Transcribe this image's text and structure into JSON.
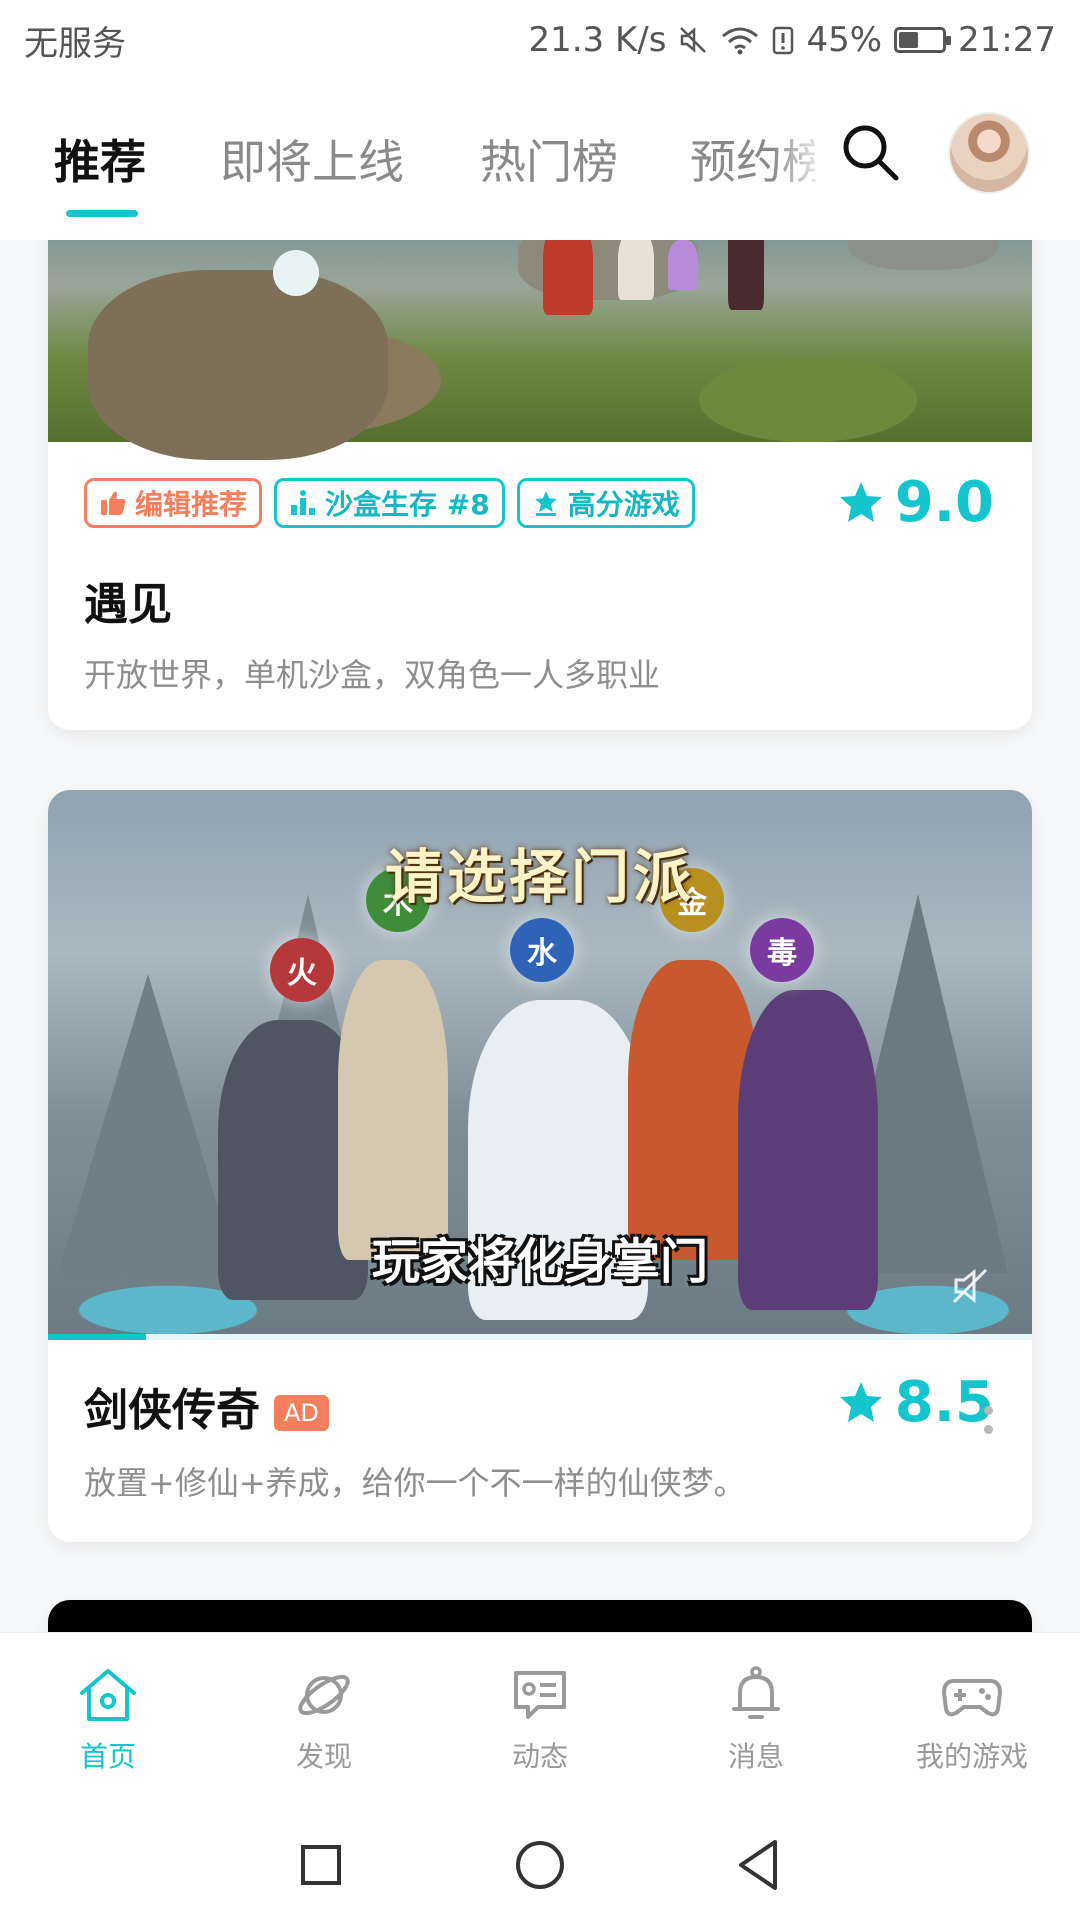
{
  "status_bar": {
    "carrier": "无服务",
    "net_speed": "21.3 K/s",
    "battery_percent": "45%",
    "battery_level": 0.45,
    "time": "21:27"
  },
  "top_tabs": [
    {
      "label": "推荐",
      "active": true
    },
    {
      "label": "即将上线",
      "active": false
    },
    {
      "label": "热门榜",
      "active": false
    },
    {
      "label": "预约榜",
      "active": false
    }
  ],
  "cards": [
    {
      "tags": [
        {
          "label": "编辑推荐",
          "icon": "thumbs-up-icon",
          "color": "#f47f5c"
        },
        {
          "label": "沙盒生存 #8",
          "icon": "ranking-icon",
          "color": "#15c5ce"
        },
        {
          "label": "高分游戏",
          "icon": "star-badge-icon",
          "color": "#15c5ce"
        }
      ],
      "rating": "9.0",
      "title": "遇见",
      "description": "开放世界，单机沙盒，双角色一人多职业"
    },
    {
      "banner_title": "请选择门派",
      "banner_caption": "玩家将化身掌门",
      "element_orbs": [
        "火",
        "木",
        "水",
        "金",
        "毒"
      ],
      "rating": "8.5",
      "title": "剑侠传奇",
      "ad_label": "AD",
      "description": "放置+修仙+养成，给你一个不一样的仙侠梦。",
      "video_progress": 0.1
    }
  ],
  "bottom_nav": [
    {
      "label": "首页",
      "icon": "home-icon",
      "active": true
    },
    {
      "label": "发现",
      "icon": "planet-icon",
      "active": false
    },
    {
      "label": "动态",
      "icon": "chat-card-icon",
      "active": false
    },
    {
      "label": "消息",
      "icon": "bell-icon",
      "active": false
    },
    {
      "label": "我的游戏",
      "icon": "gamepad-icon",
      "active": false
    }
  ],
  "colors": {
    "accent": "#15c5ce",
    "editor_tag": "#f47f5c",
    "ad_badge": "#f47f5c"
  }
}
